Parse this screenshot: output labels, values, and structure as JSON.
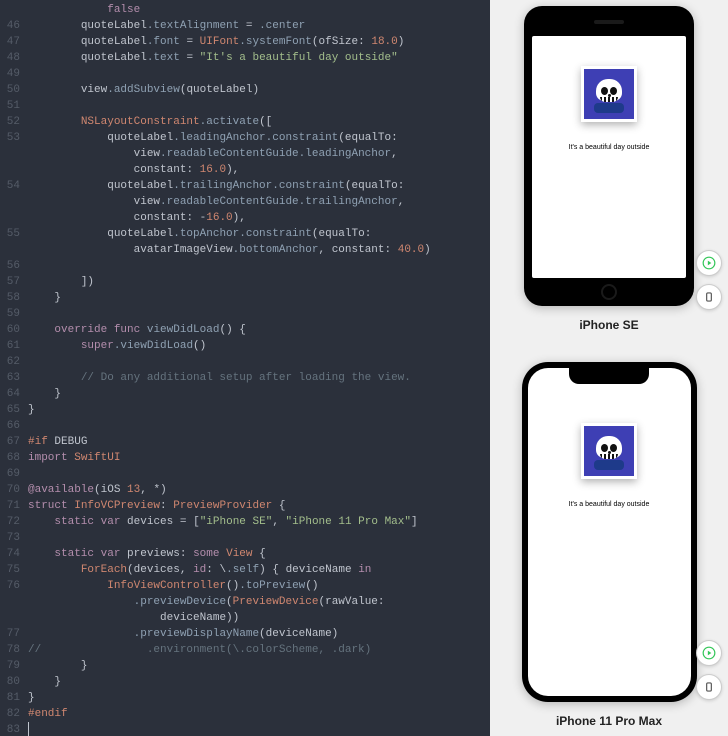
{
  "code": {
    "lines": [
      {
        "n": "",
        "t": "            false"
      },
      {
        "n": "46",
        "t": "        quoteLabel.textAlignment = .center"
      },
      {
        "n": "47",
        "t": "        quoteLabel.font = UIFont.systemFont(ofSize: 18.0)"
      },
      {
        "n": "48",
        "t": "        quoteLabel.text = \"It's a beautiful day outside\""
      },
      {
        "n": "49",
        "t": ""
      },
      {
        "n": "50",
        "t": "        view.addSubview(quoteLabel)"
      },
      {
        "n": "51",
        "t": ""
      },
      {
        "n": "52",
        "t": "        NSLayoutConstraint.activate(["
      },
      {
        "n": "53",
        "t": "            quoteLabel.leadingAnchor.constraint(equalTo:"
      },
      {
        "n": "",
        "t": "                view.readableContentGuide.leadingAnchor,"
      },
      {
        "n": "",
        "t": "                constant: 16.0),"
      },
      {
        "n": "54",
        "t": "            quoteLabel.trailingAnchor.constraint(equalTo:"
      },
      {
        "n": "",
        "t": "                view.readableContentGuide.trailingAnchor,"
      },
      {
        "n": "",
        "t": "                constant: -16.0),"
      },
      {
        "n": "55",
        "t": "            quoteLabel.topAnchor.constraint(equalTo:"
      },
      {
        "n": "",
        "t": "                avatarImageView.bottomAnchor, constant: 40.0)"
      },
      {
        "n": "56",
        "t": ""
      },
      {
        "n": "57",
        "t": "        ])"
      },
      {
        "n": "58",
        "t": "    }"
      },
      {
        "n": "59",
        "t": ""
      },
      {
        "n": "60",
        "t": "    override func viewDidLoad() {"
      },
      {
        "n": "61",
        "t": "        super.viewDidLoad()"
      },
      {
        "n": "62",
        "t": ""
      },
      {
        "n": "63",
        "t": "        // Do any additional setup after loading the view."
      },
      {
        "n": "64",
        "t": "    }"
      },
      {
        "n": "65",
        "t": "}"
      },
      {
        "n": "66",
        "t": ""
      },
      {
        "n": "67",
        "t": "#if DEBUG"
      },
      {
        "n": "68",
        "t": "import SwiftUI"
      },
      {
        "n": "69",
        "t": ""
      },
      {
        "n": "70",
        "t": "@available(iOS 13, *)"
      },
      {
        "n": "71",
        "t": "struct InfoVCPreview: PreviewProvider {"
      },
      {
        "n": "72",
        "t": "    static var devices = [\"iPhone SE\", \"iPhone 11 Pro Max\"]"
      },
      {
        "n": "73",
        "t": ""
      },
      {
        "n": "74",
        "t": "    static var previews: some View {"
      },
      {
        "n": "75",
        "t": "        ForEach(devices, id: \\.self) { deviceName in"
      },
      {
        "n": "76",
        "t": "            InfoViewController().toPreview()"
      },
      {
        "n": "",
        "t": "                .previewDevice(PreviewDevice(rawValue:"
      },
      {
        "n": "",
        "t": "                    deviceName))"
      },
      {
        "n": "77",
        "t": "                .previewDisplayName(deviceName)"
      },
      {
        "n": "78",
        "t": "//                .environment(\\.colorScheme, .dark)"
      },
      {
        "n": "79",
        "t": "        }"
      },
      {
        "n": "80",
        "t": "    }"
      },
      {
        "n": "81",
        "t": "}"
      },
      {
        "n": "82",
        "t": "#endif"
      },
      {
        "n": "83",
        "t": ""
      }
    ]
  },
  "preview": {
    "quote": "It's a beautiful day outside",
    "device_se_label": "iPhone SE",
    "device_promax_label": "iPhone 11 Pro Max"
  },
  "icons": {
    "play": "play-icon",
    "device": "device-icon"
  }
}
